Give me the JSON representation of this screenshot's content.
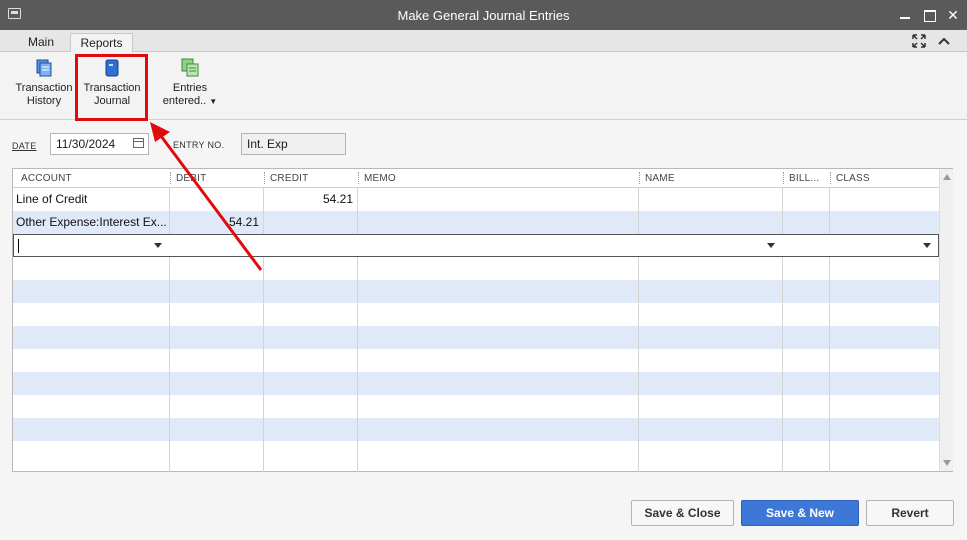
{
  "window": {
    "title": "Make General Journal Entries",
    "minimize_icon": "minimize-icon",
    "maximize_icon": "maximize-icon",
    "close_glyph": "✕"
  },
  "tabs": [
    {
      "label": "Main"
    },
    {
      "label": "Reports"
    }
  ],
  "toolbar": {
    "transaction_history": {
      "line1": "Transaction",
      "line2": "History"
    },
    "transaction_journal": {
      "line1": "Transaction",
      "line2": "Journal"
    },
    "entries_entered": {
      "line1": "Entries",
      "line2": "entered.."
    }
  },
  "form": {
    "date_label": "DATE",
    "date_value": "11/30/2024",
    "entry_label": "ENTRY NO.",
    "entry_value": "Int. Exp"
  },
  "table": {
    "columns": [
      "ACCOUNT",
      "DEBIT",
      "CREDIT",
      "MEMO",
      "NAME",
      "BILL...",
      "CLASS"
    ],
    "rows": [
      {
        "account": "Line of Credit",
        "debit": "",
        "credit": "54.21",
        "memo": "",
        "name": "",
        "billable": "",
        "class": ""
      },
      {
        "account": "Other Expense:Interest Ex...",
        "debit": "54.21",
        "credit": "",
        "memo": "",
        "name": "",
        "billable": "",
        "class": ""
      }
    ]
  },
  "buttons": {
    "save_close": "Save & Close",
    "save_new": "Save & New",
    "revert": "Revert"
  },
  "colors": {
    "highlight": "#e20b0b",
    "primary_button": "#3d78d8",
    "row_alt": "#dfe9f7",
    "titlebar": "#5a5a5a"
  }
}
